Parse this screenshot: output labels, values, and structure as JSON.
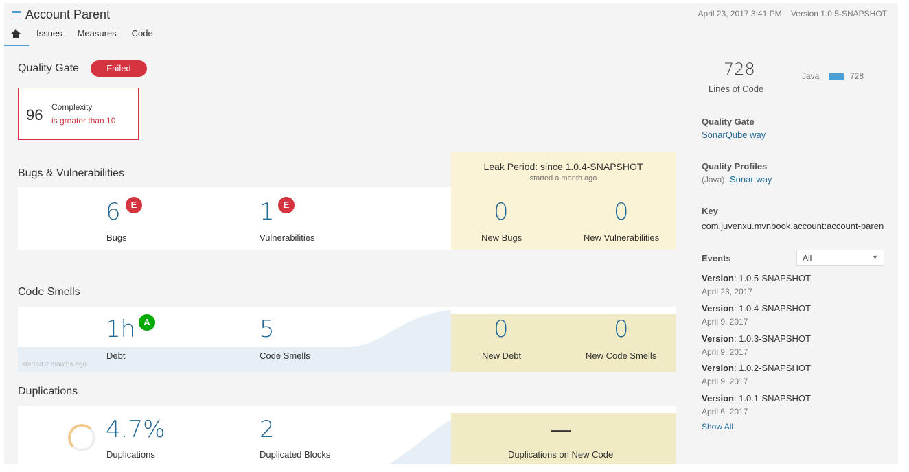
{
  "header": {
    "project_name": "Account Parent",
    "date": "April 23, 2017 3:41 PM",
    "version": "Version 1.0.5-SNAPSHOT",
    "nav": [
      "Issues",
      "Measures",
      "Code"
    ]
  },
  "quality_gate": {
    "title": "Quality Gate",
    "status": "Failed",
    "condition": {
      "value": "96",
      "metric": "Complexity",
      "operator": "is greater than 10"
    }
  },
  "leak": {
    "title": "Leak Period: since 1.0.4-SNAPSHOT",
    "subtitle": "started a month ago"
  },
  "bugs": {
    "title": "Bugs & Vulnerabilities",
    "bugs_value": "6",
    "bugs_rating": "E",
    "bugs_label": "Bugs",
    "vuln_value": "1",
    "vuln_rating": "E",
    "vuln_label": "Vulnerabilities",
    "new_bugs_value": "0",
    "new_bugs_label": "New Bugs",
    "new_vuln_value": "0",
    "new_vuln_label": "New Vulnerabilities"
  },
  "smells": {
    "title": "Code Smells",
    "debt_value": "1h",
    "debt_rating": "A",
    "debt_label": "Debt",
    "smells_value": "5",
    "smells_label": "Code Smells",
    "new_debt_value": "0",
    "new_debt_label": "New Debt",
    "new_smells_value": "0",
    "new_smells_label": "New Code Smells",
    "history_note": "started 2 months ago"
  },
  "duplications": {
    "title": "Duplications",
    "dup_value": "4.7%",
    "dup_label": "Duplications",
    "blocks_value": "2",
    "blocks_label": "Duplicated Blocks",
    "new_dup_value": "—",
    "new_dup_label": "Duplications on New Code"
  },
  "sidebar": {
    "loc_value": "728",
    "loc_label": "Lines of Code",
    "lang_name": "Java",
    "lang_value": "728",
    "quality_gate_title": "Quality Gate",
    "quality_gate_link": "SonarQube way",
    "profiles_title": "Quality Profiles",
    "profile_lang": "(Java)",
    "profile_link": "Sonar way",
    "key_title": "Key",
    "key_value": "com.juvenxu.mvnbook.account:account-parent",
    "events_title": "Events",
    "events_filter": "All",
    "events": [
      {
        "prefix": "Version",
        "name": ": 1.0.5-SNAPSHOT",
        "date": "April 23, 2017"
      },
      {
        "prefix": "Version",
        "name": ": 1.0.4-SNAPSHOT",
        "date": "April 9, 2017"
      },
      {
        "prefix": "Version",
        "name": ": 1.0.3-SNAPSHOT",
        "date": "April 9, 2017"
      },
      {
        "prefix": "Version",
        "name": ": 1.0.2-SNAPSHOT",
        "date": "April 9, 2017"
      },
      {
        "prefix": "Version",
        "name": ": 1.0.1-SNAPSHOT",
        "date": "April 6, 2017"
      }
    ],
    "show_all": "Show All"
  },
  "colors": {
    "accent": "#4b9fd5",
    "error": "#d4333f",
    "ok": "#00aa00",
    "leak_bg": "#fbf3d5",
    "number": "#236a97"
  }
}
